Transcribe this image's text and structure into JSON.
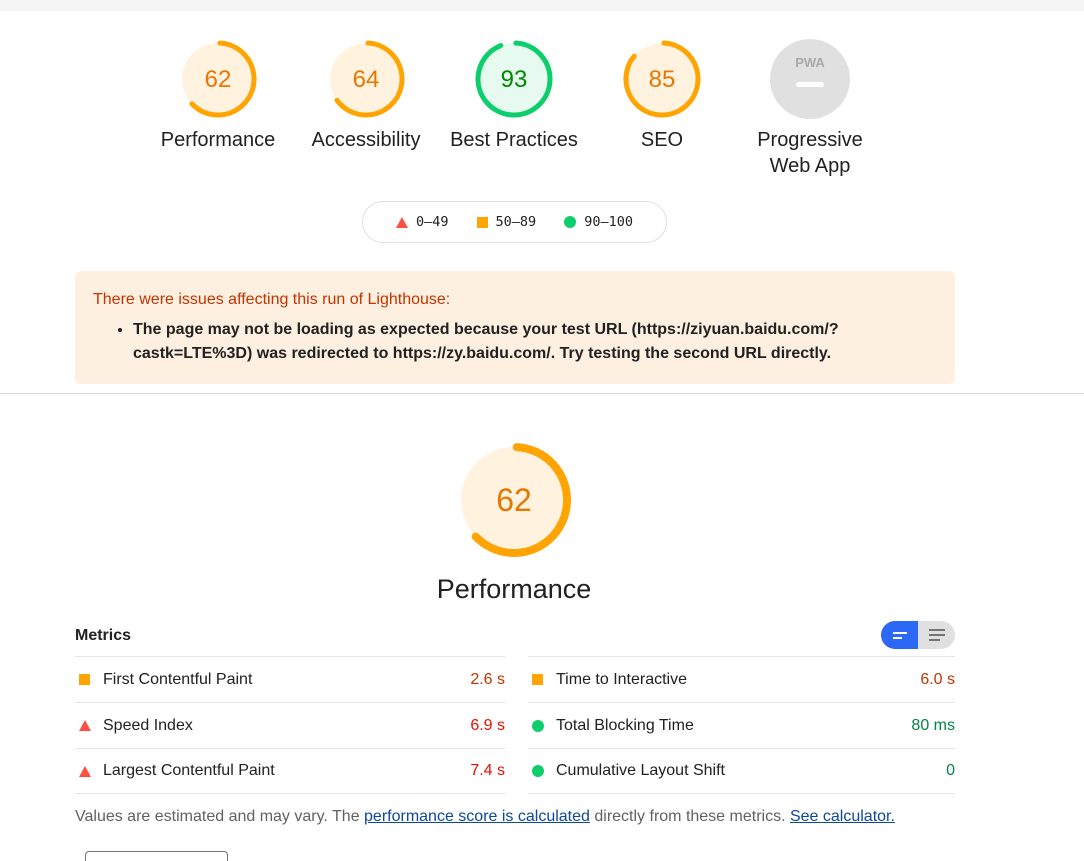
{
  "colors": {
    "pass": "#0cce6b",
    "average": "#ffa400",
    "fail": "#ff4e42",
    "pass_bg": "#e6faf0",
    "average_bg": "#fff3e0",
    "na": "#e0e0e0",
    "toggle_active": "#2a68f5"
  },
  "summary": {
    "gauges": [
      {
        "label": "Performance",
        "score": 62,
        "rating": "average"
      },
      {
        "label": "Accessibility",
        "score": 64,
        "rating": "average"
      },
      {
        "label": "Best Practices",
        "score": 93,
        "rating": "pass"
      },
      {
        "label": "SEO",
        "score": 85,
        "rating": "average"
      },
      {
        "label": "Progressive Web App",
        "label_line1": "Progressive",
        "label_line2": "Web App",
        "badge": "PWA",
        "icon": "pwa-icon",
        "rating": "na"
      }
    ]
  },
  "legend": {
    "items": [
      {
        "icon": "triangle-icon",
        "range": "0–49"
      },
      {
        "icon": "square-icon",
        "range": "50–89"
      },
      {
        "icon": "circle-icon",
        "range": "90–100"
      }
    ]
  },
  "warning": {
    "title": "There were issues affecting this run of Lighthouse:",
    "items": [
      "The page may not be loading as expected because your test URL (https://ziyuan.baidu.com/?castk=LTE%3D) was redirected to https://zy.baidu.com/. Try testing the second URL directly."
    ]
  },
  "performance": {
    "score": 62,
    "title": "Performance"
  },
  "metrics": {
    "title": "Metrics",
    "toggle": {
      "active": "compact-view",
      "options": [
        "compact-view",
        "expanded-view"
      ]
    },
    "left": [
      {
        "name": "First Contentful Paint",
        "value": "2.6 s",
        "rating": "average"
      },
      {
        "name": "Speed Index",
        "value": "6.9 s",
        "rating": "fail"
      },
      {
        "name": "Largest Contentful Paint",
        "value": "7.4 s",
        "rating": "fail"
      }
    ],
    "right": [
      {
        "name": "Time to Interactive",
        "value": "6.0 s",
        "rating": "average"
      },
      {
        "name": "Total Blocking Time",
        "value": "80 ms",
        "rating": "pass"
      },
      {
        "name": "Cumulative Layout Shift",
        "value": "0",
        "rating": "pass"
      }
    ]
  },
  "footnote": {
    "text1": "Values are estimated and may vary. The ",
    "link1": "performance score is calculated",
    "text2": " directly from these metrics. ",
    "link2": "See calculator."
  }
}
